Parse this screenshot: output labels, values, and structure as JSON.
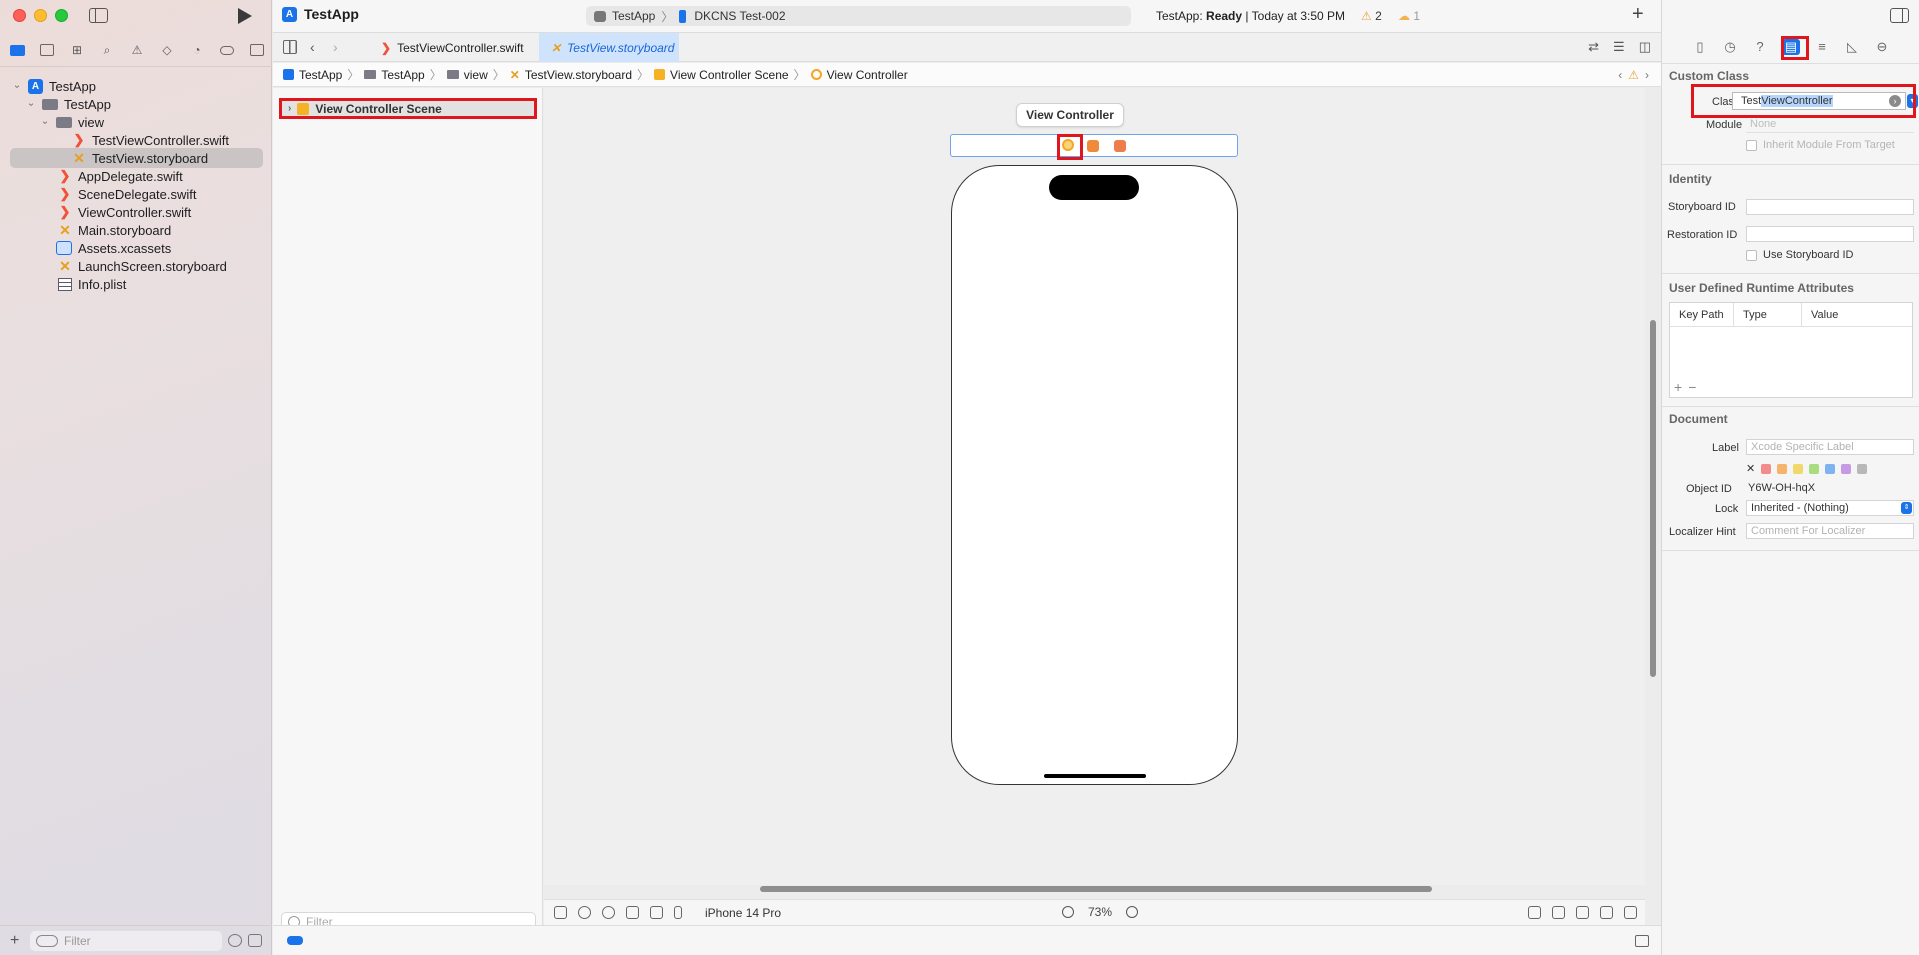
{
  "app": {
    "title": "TestApp"
  },
  "scheme": {
    "project": "TestApp",
    "device": "DKCNS Test-002"
  },
  "status": {
    "app_name": "TestApp:",
    "state": "Ready",
    "time_text": "| Today at 3:50 PM",
    "warnings": "2",
    "issues": "1"
  },
  "navigator": {
    "tree": [
      {
        "label": "TestApp",
        "icon": "app-icon",
        "depth": 0
      },
      {
        "label": "TestApp",
        "icon": "folder-icon",
        "depth": 1
      },
      {
        "label": "view",
        "icon": "folder-icon",
        "depth": 2
      },
      {
        "label": "TestViewController.swift",
        "icon": "swift-file-icon",
        "depth": 3
      },
      {
        "label": "TestView.storyboard",
        "icon": "storyboard-file-icon",
        "depth": 3,
        "selected": true
      },
      {
        "label": "AppDelegate.swift",
        "icon": "swift-file-icon",
        "depth": 2
      },
      {
        "label": "SceneDelegate.swift",
        "icon": "swift-file-icon",
        "depth": 2
      },
      {
        "label": "ViewController.swift",
        "icon": "swift-file-icon",
        "depth": 2
      },
      {
        "label": "Main.storyboard",
        "icon": "storyboard-file-icon",
        "depth": 2
      },
      {
        "label": "Assets.xcassets",
        "icon": "assets-icon",
        "depth": 2
      },
      {
        "label": "LaunchScreen.storyboard",
        "icon": "storyboard-file-icon",
        "depth": 2
      },
      {
        "label": "Info.plist",
        "icon": "plist-icon",
        "depth": 2
      }
    ],
    "filter_placeholder": "Filter"
  },
  "tabs": [
    {
      "label": "TestViewController.swift",
      "active": false
    },
    {
      "label": "TestView.storyboard",
      "active": true
    }
  ],
  "breadcrumb": [
    "TestApp",
    "TestApp",
    "view",
    "TestView.storyboard",
    "View Controller Scene",
    "View Controller"
  ],
  "outline": {
    "scene_label": "View Controller Scene",
    "filter_placeholder": "Filter"
  },
  "canvas": {
    "scene_title": "View Controller",
    "device_name": "iPhone 14 Pro",
    "zoom": "73%"
  },
  "inspector": {
    "custom_class": {
      "title": "Custom Class",
      "class_label": "Class",
      "class_prefix": "Test",
      "class_selected": "ViewController",
      "module_label": "Module",
      "module_value": "None",
      "inherit_label": "Inherit Module From Target"
    },
    "identity": {
      "title": "Identity",
      "storyboard_id_label": "Storyboard ID",
      "restoration_id_label": "Restoration ID",
      "use_storyboard_id_label": "Use Storyboard ID"
    },
    "runtime_attributes": {
      "title": "User Defined Runtime Attributes",
      "columns": [
        "Key Path",
        "Type",
        "Value"
      ]
    },
    "document": {
      "title": "Document",
      "label_label": "Label",
      "label_placeholder": "Xcode Specific Label",
      "object_id_label": "Object ID",
      "object_id_value": "Y6W-OH-hqX",
      "lock_label": "Lock",
      "lock_value": "Inherited - (Nothing)",
      "localizer_label": "Localizer Hint",
      "localizer_placeholder": "Comment For Localizer",
      "label_colors": [
        "#f28b8b",
        "#f5b46a",
        "#f2d86a",
        "#a8dc80",
        "#7fb2f0",
        "#c79ae6",
        "#b8b8b8"
      ]
    }
  },
  "colors": {
    "accent": "#1a73e8",
    "highlight_red": "#e0161e"
  }
}
